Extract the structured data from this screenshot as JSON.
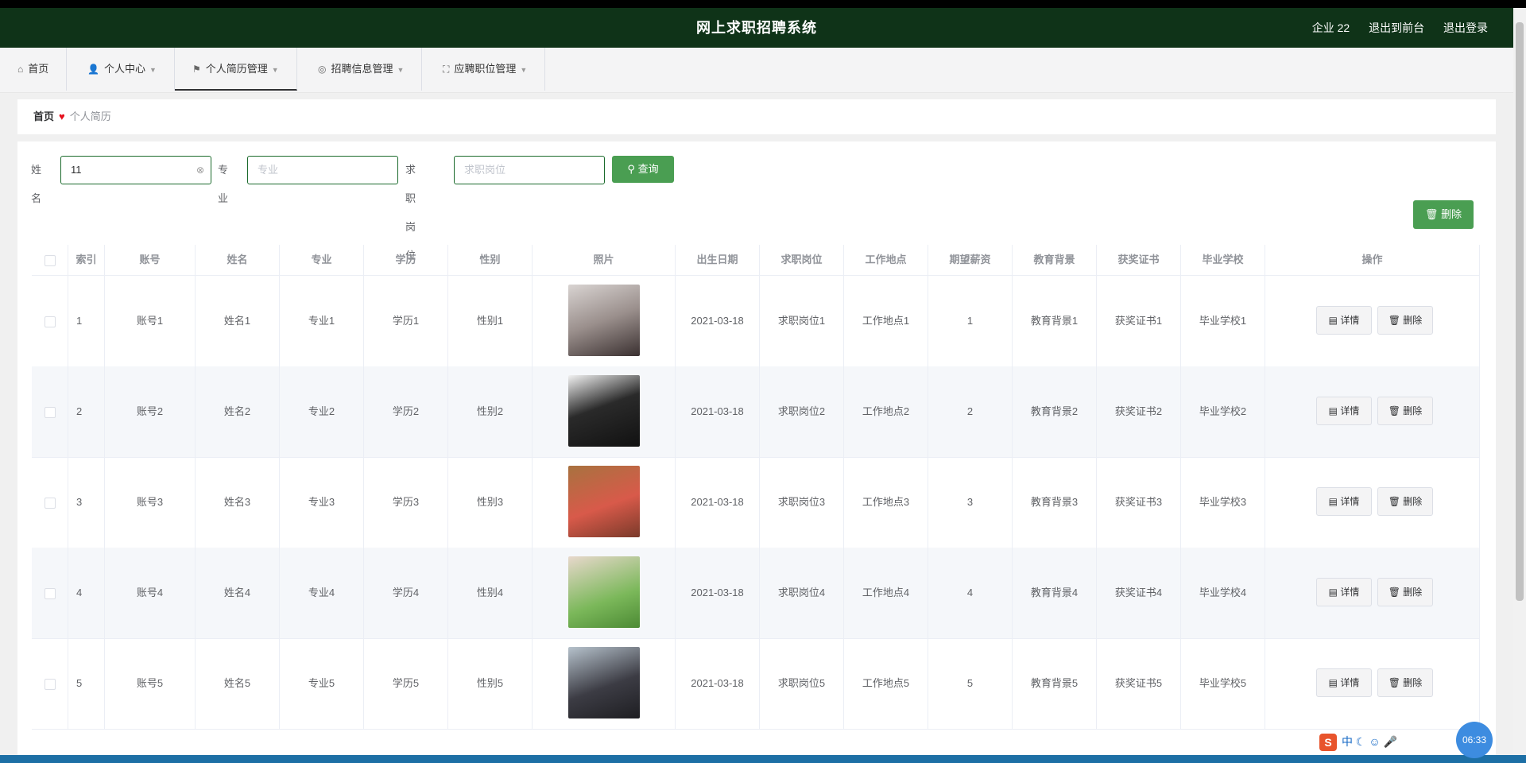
{
  "header": {
    "title": "网上求职招聘系统",
    "user": "企业 22",
    "to_front": "退出到前台",
    "logout": "退出登录"
  },
  "nav": [
    {
      "label": "首页",
      "icon": "home-icon"
    },
    {
      "label": "个人中心",
      "icon": "user-icon"
    },
    {
      "label": "个人简历管理",
      "icon": "flag-icon"
    },
    {
      "label": "招聘信息管理",
      "icon": "circle-icon"
    },
    {
      "label": "应聘职位管理",
      "icon": "expand-icon"
    }
  ],
  "breadcrumb": {
    "home": "首页",
    "current": "个人简历"
  },
  "search": {
    "name_label": "姓名",
    "name_value": "11",
    "major_label": "专业",
    "major_placeholder": "专业",
    "job_label": "求职岗位",
    "job_placeholder": "求职岗位",
    "query_button": "查询"
  },
  "toolbar": {
    "delete_button": "删除"
  },
  "table": {
    "columns": [
      "索引",
      "账号",
      "姓名",
      "专业",
      "学历",
      "性别",
      "照片",
      "出生日期",
      "求职岗位",
      "工作地点",
      "期望薪资",
      "教育背景",
      "获奖证书",
      "毕业学校",
      "操作"
    ],
    "rows": [
      {
        "index": "1",
        "account": "账号1",
        "name": "姓名1",
        "major": "专业1",
        "edu": "学历1",
        "gender": "性别1",
        "birth": "2021-03-18",
        "job": "求职岗位1",
        "place": "工作地点1",
        "salary": "1",
        "background": "教育背景1",
        "cert": "获奖证书1",
        "school": "毕业学校1"
      },
      {
        "index": "2",
        "account": "账号2",
        "name": "姓名2",
        "major": "专业2",
        "edu": "学历2",
        "gender": "性别2",
        "birth": "2021-03-18",
        "job": "求职岗位2",
        "place": "工作地点2",
        "salary": "2",
        "background": "教育背景2",
        "cert": "获奖证书2",
        "school": "毕业学校2"
      },
      {
        "index": "3",
        "account": "账号3",
        "name": "姓名3",
        "major": "专业3",
        "edu": "学历3",
        "gender": "性别3",
        "birth": "2021-03-18",
        "job": "求职岗位3",
        "place": "工作地点3",
        "salary": "3",
        "background": "教育背景3",
        "cert": "获奖证书3",
        "school": "毕业学校3"
      },
      {
        "index": "4",
        "account": "账号4",
        "name": "姓名4",
        "major": "专业4",
        "edu": "学历4",
        "gender": "性别4",
        "birth": "2021-03-18",
        "job": "求职岗位4",
        "place": "工作地点4",
        "salary": "4",
        "background": "教育背景4",
        "cert": "获奖证书4",
        "school": "毕业学校4"
      },
      {
        "index": "5",
        "account": "账号5",
        "name": "姓名5",
        "major": "专业5",
        "edu": "学历5",
        "gender": "性别5",
        "birth": "2021-03-18",
        "job": "求职岗位5",
        "place": "工作地点5",
        "salary": "5",
        "background": "教育背景5",
        "cert": "获奖证书5",
        "school": "毕业学校5"
      }
    ],
    "detail_button": "详情",
    "delete_button": "删除"
  },
  "system": {
    "ime": "中",
    "clock": "06:33"
  }
}
